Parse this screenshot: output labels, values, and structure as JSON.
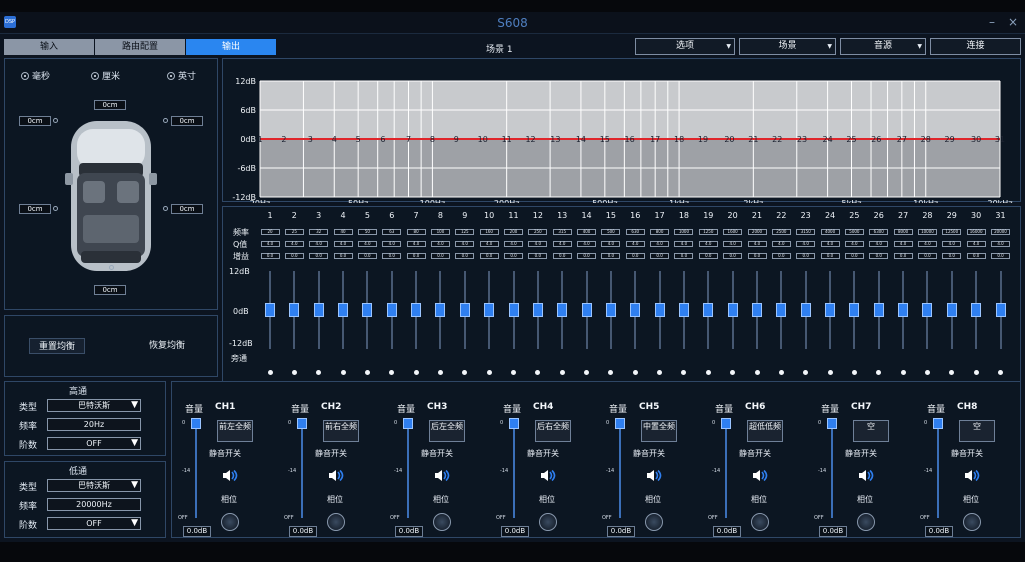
{
  "app": {
    "logo_text": "DSP",
    "title": "S608",
    "minimize": "–",
    "close": "×"
  },
  "tabs": [
    {
      "label": "输入"
    },
    {
      "label": "路由配置"
    },
    {
      "label": "输出",
      "active": true
    }
  ],
  "scene": {
    "label": "场景 1"
  },
  "top_buttons": [
    {
      "label": "选项"
    },
    {
      "label": "场景"
    },
    {
      "label": "音源"
    },
    {
      "label": "连接"
    }
  ],
  "delay": {
    "units": [
      {
        "label": "毫秒",
        "selected": true
      },
      {
        "label": "厘米",
        "selected": true
      },
      {
        "label": "英寸",
        "selected": true
      }
    ],
    "values": [
      "0cm",
      "0cm",
      "0cm",
      "0cm",
      "0cm",
      "0cm",
      "0cm"
    ]
  },
  "balance": {
    "reset_label": "重置均衡",
    "restore_label": "恢复均衡"
  },
  "graph": {
    "y_labels": [
      "12dB",
      "6dB",
      "0dB",
      "-6dB",
      "-12dB"
    ],
    "x_labels": [
      "20Hz",
      "50Hz",
      "100Hz",
      "200Hz",
      "500Hz",
      "1kHz",
      "2kHz",
      "5kHz",
      "10kHz",
      "20kHz"
    ],
    "band_markers": [
      "1",
      "2",
      "3",
      "4",
      "5",
      "6",
      "7",
      "8",
      "9",
      "10",
      "11",
      "12",
      "13",
      "14",
      "15",
      "16",
      "17",
      "18",
      "19",
      "20",
      "21",
      "22",
      "23",
      "24",
      "25",
      "26",
      "27",
      "28",
      "29",
      "30",
      "31"
    ],
    "curve_color": "#e0262b"
  },
  "eq": {
    "row_labels": {
      "freq": "频率",
      "q": "Q值",
      "gain": "增益",
      "bypass": "旁通"
    },
    "scale": {
      "top": "12dB",
      "mid": "0dB",
      "bottom": "-12dB"
    },
    "bands": [
      "1",
      "2",
      "3",
      "4",
      "5",
      "6",
      "7",
      "8",
      "9",
      "10",
      "11",
      "12",
      "13",
      "14",
      "15",
      "16",
      "17",
      "18",
      "19",
      "20",
      "21",
      "22",
      "23",
      "24",
      "25",
      "26",
      "27",
      "28",
      "29",
      "30",
      "31"
    ],
    "freqs": [
      "20",
      "25",
      "32",
      "40",
      "50",
      "63",
      "80",
      "100",
      "125",
      "160",
      "200",
      "250",
      "315",
      "400",
      "500",
      "630",
      "800",
      "1000",
      "1250",
      "1600",
      "2000",
      "2500",
      "3150",
      "4000",
      "5000",
      "6300",
      "8000",
      "10000",
      "12500",
      "16000",
      "20000"
    ],
    "q_value": "4.0",
    "gain_value": "0.0"
  },
  "highpass": {
    "title": "高通",
    "type_label": "类型",
    "type_value": "巴特沃斯",
    "freq_label": "频率",
    "freq_value": "20Hz",
    "order_label": "阶数",
    "order_value": "OFF"
  },
  "lowpass": {
    "title": "低通",
    "type_label": "类型",
    "type_value": "巴特沃斯",
    "freq_label": "频率",
    "freq_value": "20000Hz",
    "order_label": "阶数",
    "order_value": "OFF"
  },
  "channels": {
    "volume_label": "音量",
    "mute_label": "静音开关",
    "phase_label": "相位",
    "scale_top": "0",
    "scale_mid": "-14",
    "scale_bottom": "OFF",
    "items": [
      {
        "id": "CH1",
        "name": "前左全频",
        "db": "0.0dB"
      },
      {
        "id": "CH2",
        "name": "前右全频",
        "db": "0.0dB"
      },
      {
        "id": "CH3",
        "name": "后左全频",
        "db": "0.0dB"
      },
      {
        "id": "CH4",
        "name": "后右全频",
        "db": "0.0dB"
      },
      {
        "id": "CH5",
        "name": "中置全频",
        "db": "0.0dB"
      },
      {
        "id": "CH6",
        "name": "超低低频",
        "db": "0.0dB"
      },
      {
        "id": "CH7",
        "name": "空",
        "db": "0.0dB"
      },
      {
        "id": "CH8",
        "name": "空",
        "db": "0.0dB"
      }
    ]
  }
}
